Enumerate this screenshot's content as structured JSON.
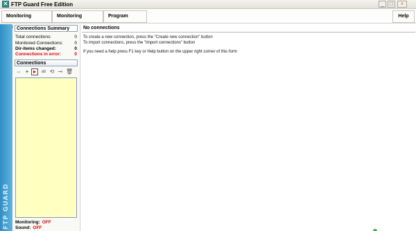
{
  "window": {
    "title": "FTP Guard Free Edition",
    "controls": {
      "minimize": "_",
      "maximize": "□",
      "close": "×"
    }
  },
  "toolbar": {
    "monitoring_results": "Monitoring Results",
    "monitoring_settings": "Monitoring Settings",
    "program_options": "Program Options",
    "help": "Help"
  },
  "sidebar": {
    "brand_label": "FTP GUARD"
  },
  "summary": {
    "heading": "Connections Summary",
    "rows": [
      {
        "label": "Total connections:",
        "value": "0"
      },
      {
        "label": "Monitored Connections:",
        "value": "0"
      },
      {
        "label": "Dir-items changed:",
        "value": "0"
      },
      {
        "label": "Connections in error:",
        "value": "0"
      }
    ]
  },
  "connections": {
    "heading": "Connections",
    "tool_icons": [
      "connect-icon",
      "add-connection-icon",
      "import-connection-icon",
      "edit-connection-icon",
      "refresh-icon",
      "key-icon",
      "delete-icon"
    ]
  },
  "status": {
    "monitoring_label": "Monitoring:",
    "monitoring_value": "OFF",
    "sound_label": "Sound:",
    "sound_value": "OFF"
  },
  "main": {
    "title": "No connections",
    "lines": [
      "To create a new connection, press the \"Create new connection\" button",
      "To import connections, press the \"Import connections\" button",
      "If you need a help press F1 key or Help button on the upper right corner of this form"
    ]
  },
  "colors": {
    "accent": "#2f8fc4",
    "error": "#e00000",
    "list_bg": "#ffffc0"
  }
}
